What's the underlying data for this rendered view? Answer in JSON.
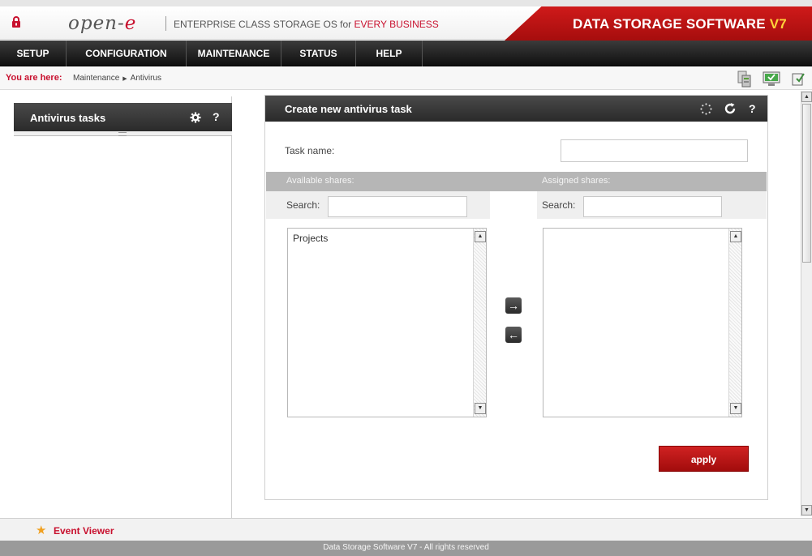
{
  "header": {
    "logo_text": "open-",
    "logo_e": "e",
    "tagline_pre": "ENTERPRISE CLASS STORAGE OS for ",
    "tagline_em": "EVERY BUSINESS",
    "brand_text": "DATA STORAGE SOFTWARE ",
    "brand_version": "V7"
  },
  "nav": {
    "items": [
      "SETUP",
      "CONFIGURATION",
      "MAINTENANCE",
      "STATUS",
      "HELP"
    ]
  },
  "breadcrumb": {
    "label": "You are here:",
    "items": [
      "Maintenance",
      "Antivirus"
    ]
  },
  "left_panel": {
    "title": "Antivirus tasks",
    "settings_icon": "gear-icon",
    "help_icon": "?"
  },
  "main_panel": {
    "title": "Create new antivirus task",
    "loading_icon": "spinner-icon",
    "refresh_icon": "C",
    "help_icon": "?",
    "task_name_label": "Task name:",
    "task_name_value": "",
    "available_label": "Available shares:",
    "assigned_label": "Assigned shares:",
    "search_label_left": "Search:",
    "search_label_right": "Search:",
    "available_items": [
      "Projects"
    ],
    "assigned_items": [],
    "move_right_icon": "→",
    "move_left_icon": "←",
    "apply_label": "apply"
  },
  "bottom": {
    "event_viewer_label": "Event Viewer",
    "footer_text": "Data Storage Software V7 - All rights reserved"
  },
  "colors": {
    "accent_red": "#c8102e",
    "nav_dark": "#1a1a1a",
    "version_yellow": "#ffd23a"
  }
}
